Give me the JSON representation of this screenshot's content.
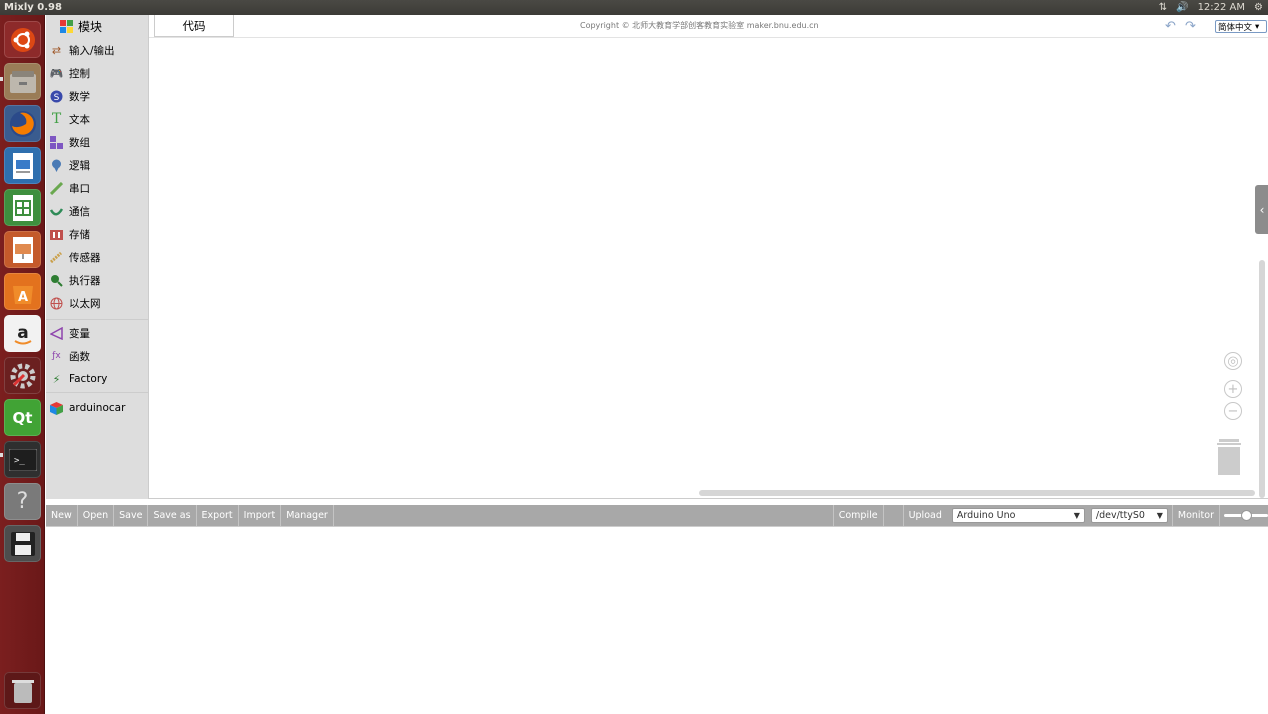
{
  "topbar": {
    "title": "Mixly 0.98",
    "time": "12:22 AM"
  },
  "launcher": {
    "items": [
      "ubuntu-dash-icon",
      "files-icon",
      "firefox-icon",
      "writer-icon",
      "calc-icon",
      "impress-icon",
      "software-center-icon",
      "amazon-icon",
      "settings-icon",
      "qt-creator-icon",
      "terminal-icon",
      "help-icon",
      "floppy-disk-icon"
    ],
    "trash": "trash-icon"
  },
  "categories": {
    "header": "模块",
    "items": [
      {
        "label": "输入/输出",
        "icon": "io-icon",
        "color": "#a05a2c"
      },
      {
        "label": "控制",
        "icon": "gamepad-icon",
        "color": "#2e7d32"
      },
      {
        "label": "数学",
        "icon": "math-icon",
        "color": "#3949ab"
      },
      {
        "label": "文本",
        "icon": "text-icon",
        "color": "#43a047"
      },
      {
        "label": "数组",
        "icon": "array-icon",
        "color": "#7e57c2"
      },
      {
        "label": "逻辑",
        "icon": "logic-icon",
        "color": "#4a7ab5"
      },
      {
        "label": "串口",
        "icon": "serial-icon",
        "color": "#6aa84f"
      },
      {
        "label": "通信",
        "icon": "comm-icon",
        "color": "#2e8b57"
      },
      {
        "label": "存储",
        "icon": "storage-icon",
        "color": "#c0504d"
      },
      {
        "label": "传感器",
        "icon": "sensor-icon",
        "color": "#caa04a"
      },
      {
        "label": "执行器",
        "icon": "actuator-icon",
        "color": "#2e7d32"
      },
      {
        "label": "以太网",
        "icon": "ethernet-icon",
        "color": "#c0504d"
      },
      {
        "label": "变量",
        "icon": "variable-icon",
        "color": "#8e44ad"
      },
      {
        "label": "函数",
        "icon": "function-icon",
        "color": "#8e44ad"
      },
      {
        "label": "Factory",
        "icon": "lightning-icon",
        "color": "#2e7d32"
      },
      {
        "label": "arduinocar",
        "icon": "cube-icon",
        "color": "#e53935"
      }
    ]
  },
  "workspace": {
    "tab": "代码",
    "copyright": "Copyright © 北师大教育学部创客教育实验室 maker.bnu.edu.cn",
    "language": "简体中文"
  },
  "toolbar": {
    "new": "New",
    "open": "Open",
    "save": "Save",
    "save_as": "Save as",
    "export": "Export",
    "import": "Import",
    "manager": "Manager",
    "compile": "Compile",
    "upload": "Upload",
    "board": "Arduino Uno",
    "port": "/dev/ttyS0",
    "monitor": "Monitor"
  }
}
